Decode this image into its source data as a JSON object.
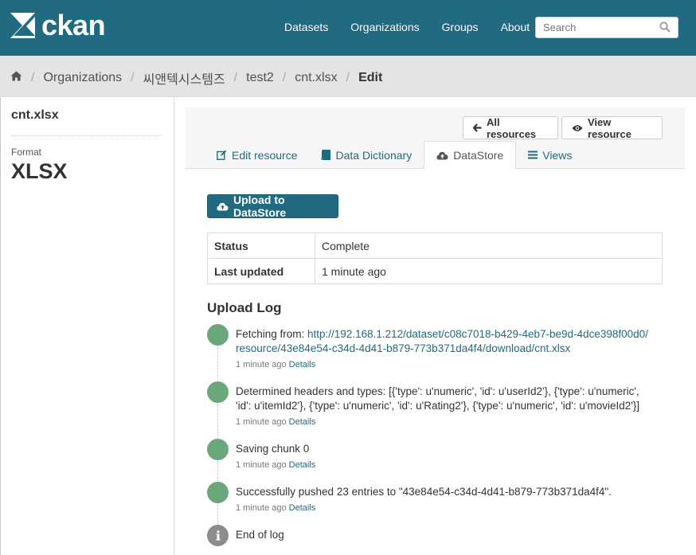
{
  "header": {
    "logo_text": "ckan",
    "nav": [
      "Datasets",
      "Organizations",
      "Groups",
      "About"
    ],
    "search_placeholder": "Search",
    "bg_color": "#206b82"
  },
  "breadcrumb": {
    "items": [
      "Organizations",
      "씨앤텍시스템즈",
      "test2",
      "cnt.xlsx"
    ],
    "active": "Edit"
  },
  "sidebar": {
    "resource_name": "cnt.xlsx",
    "format_label": "Format",
    "format_value": "XLSX"
  },
  "actions": {
    "all_resources": "All resources",
    "view_resource": "View resource"
  },
  "tabs": {
    "edit_resource": "Edit resource",
    "data_dictionary": "Data Dictionary",
    "datastore": "DataStore",
    "views": "Views"
  },
  "upload_button": "Upload to DataStore",
  "status": {
    "status_label": "Status",
    "status_value": "Complete",
    "updated_label": "Last updated",
    "updated_value": "1 minute ago"
  },
  "log": {
    "title": "Upload Log",
    "entries": [
      {
        "prefix": "Fetching from: ",
        "link": "http://192.168.1.212/dataset/c08c7018-b429-4eb7-be9d-4dce398f00d0/resource/43e84e54-c34d-4d41-b879-773b371da4f4/download/cnt.xlsx",
        "time": "1 minute ago",
        "details": "Details"
      },
      {
        "message": "Determined headers and types: [{'type': u'numeric', 'id': u'userId2'}, {'type': u'numeric', 'id': u'itemId2'}, {'type': u'numeric', 'id': u'Rating2'}, {'type': u'numeric', 'id': u'movieId2'}]",
        "time": "1 minute ago",
        "details": "Details"
      },
      {
        "message": "Saving chunk 0",
        "time": "1 minute ago",
        "details": "Details"
      },
      {
        "message": "Successfully pushed 23 entries to \"43e84e54-c34d-4d41-b879-773b371da4f4\".",
        "time": "1 minute ago",
        "details": "Details"
      },
      {
        "message": "End of log"
      }
    ]
  }
}
